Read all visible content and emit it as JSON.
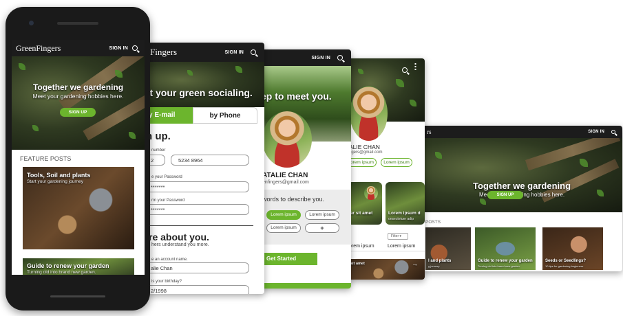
{
  "brand": "GreenFingers",
  "nav": {
    "signin": "SIGN IN",
    "search_icon": "search-icon",
    "menu_icon": "kebab-menu-icon"
  },
  "screen1": {
    "hero_title": "Together we gardening",
    "hero_sub": "Meet your gardening hobbies here.",
    "signup": "SIGN UP",
    "section": "FEATURE POSTS",
    "posts": [
      {
        "title": "Tools, Soil and plants",
        "sub": "Start your gardening journey"
      },
      {
        "title": "Guide to renew your garden",
        "sub": "Turning old into brand new garden."
      }
    ]
  },
  "screen2": {
    "logo_partial": "Fingers",
    "hero_title": "rt your green socialing.",
    "tab_email": "y E-mail",
    "tab_phone": "by Phone",
    "heading": "n up.",
    "phone_label": "number",
    "phone_code": "2",
    "phone_value": "5234 8964",
    "pw_label": "e your Password",
    "pw_value": "*******",
    "confirm_label": "rm your Password",
    "confirm_value": "*******",
    "about_heading": "re about you.",
    "about_sub": "hers understand you more.",
    "account_label": "e an account name.",
    "account_value": "alie Chan",
    "birthday_label": "is your birthday?",
    "birthday_value": "2/1998"
  },
  "screen3": {
    "signin": "SIGN IN",
    "hero_title": "ep to meet you.",
    "name": "ATALIE CHAN",
    "email": "enfingers@gmail.com",
    "words_heading": "words to describe you.",
    "pills": [
      "Lorem ipsum",
      "Lorem ipsum",
      "Lorem ipsum",
      "+"
    ],
    "cta": "Get Started"
  },
  "screen4": {
    "name": "ALIE CHAN",
    "email": "ngers@gmail.com",
    "pills": [
      "orem ipsum",
      "Lorem ipsum"
    ],
    "card1": "lar sit amet",
    "card2_title": "Lorem ipsum d",
    "card2_sub": "onsectetuer adip",
    "filter": "Filter",
    "col1": "orem ipsum",
    "col2": "Lorem ipsum",
    "bottom_card": "sit amet"
  },
  "screen5": {
    "logo_partial": "rs",
    "signin": "SIGN IN",
    "hero_title": "Together we gardening",
    "hero_sub": "Meet your gardening hobbies here.",
    "signup": "SIGN UP",
    "section": "POSTS",
    "posts": [
      {
        "title": "l and plants",
        "sub": "g journey"
      },
      {
        "title": "Guide to renew your garden",
        "sub": "Turning old into brand new garden."
      },
      {
        "title": "Seeds or Seedlings?",
        "sub": "10 tips for gardening beginners."
      }
    ]
  }
}
